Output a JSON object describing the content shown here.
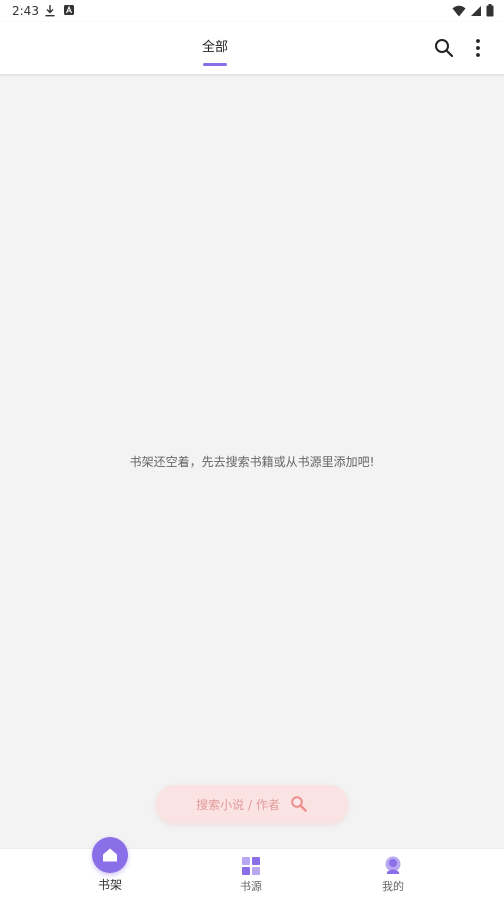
{
  "status_bar": {
    "time": "2:43",
    "icons": [
      "download-icon",
      "a-icon",
      "wifi-icon",
      "signal-icon",
      "battery-icon"
    ]
  },
  "app_bar": {
    "tab_label": "全部",
    "accent_color": "#8b6fe8"
  },
  "bookshelf": {
    "empty_message": "书架还空着，先去搜索书籍或从书源里添加吧!"
  },
  "search_pill": {
    "label": "搜索小说 / 作者"
  },
  "bottom_nav": {
    "items": [
      {
        "label": "书架",
        "icon": "home-icon",
        "selected": true
      },
      {
        "label": "书源",
        "icon": "grid-icon",
        "selected": false
      },
      {
        "label": "我的",
        "icon": "profile-icon",
        "selected": false
      }
    ]
  }
}
